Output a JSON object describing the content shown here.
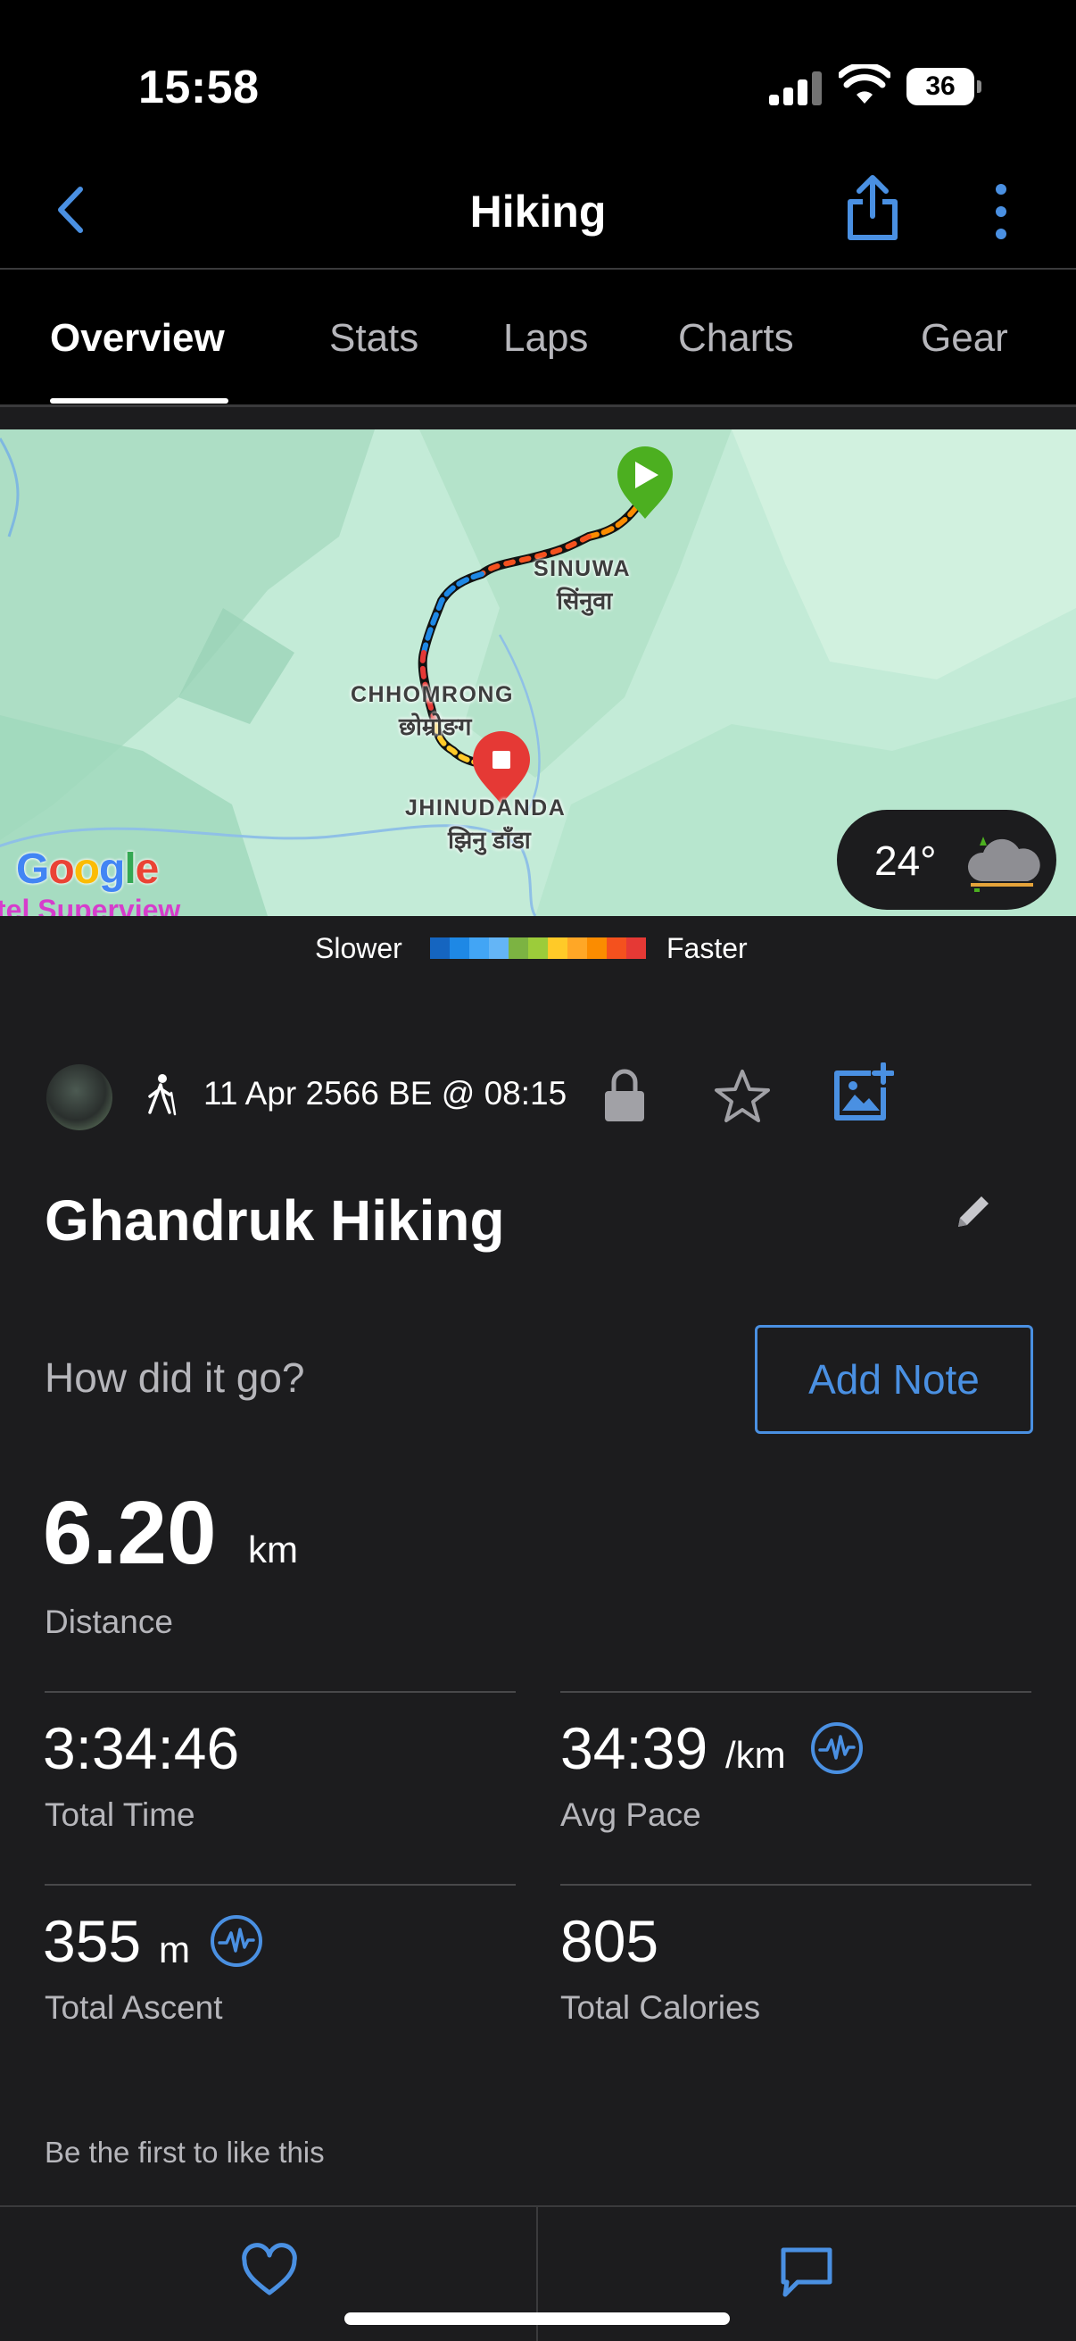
{
  "status_bar": {
    "time": "15:58",
    "battery": "36",
    "icons": [
      "signal-icon",
      "wifi-icon",
      "battery-icon"
    ]
  },
  "header": {
    "title": "Hiking",
    "icons": [
      "chevron-left-icon",
      "share-icon",
      "more-vertical-icon"
    ],
    "accent_color": "#4a90e2"
  },
  "tabs": [
    {
      "label": "Overview",
      "active": true
    },
    {
      "label": "Stats",
      "active": false
    },
    {
      "label": "Laps",
      "active": false
    },
    {
      "label": "Charts",
      "active": false
    },
    {
      "label": "Gear",
      "active": false
    }
  ],
  "map": {
    "labels": {
      "sinuwa": "SINUWA",
      "sinuwa_local": "सिंनुवा",
      "chhomrong": "CHHOMRONG",
      "chhomrong_local": "छोम्रोङग",
      "jhinudanda": "JHINUDANDA",
      "jhinudanda_local": "झिनु डाँडा"
    },
    "provider": "Google",
    "overflow_text": "tel Superview",
    "weather_temp": "24°",
    "start_color": "#4caf20",
    "end_color": "#e53935"
  },
  "legend": {
    "slower": "Slower",
    "faster": "Faster",
    "colors": [
      "#1565c0",
      "#1e88e5",
      "#42a5f5",
      "#64b5f6",
      "#7cb342",
      "#9ccc3a",
      "#ffca28",
      "#ffa726",
      "#fb8c00",
      "#f4511e",
      "#e53935"
    ]
  },
  "activity": {
    "date": "11 Apr 2566 BE @ 08:15",
    "title": "Ghandruk Hiking",
    "note_prompt": "How did it go?",
    "add_note_label": "Add Note"
  },
  "stats": {
    "distance": {
      "value": "6.20",
      "unit": "km",
      "label": "Distance"
    },
    "total_time": {
      "value": "3:34:46",
      "label": "Total Time"
    },
    "avg_pace": {
      "value": "34:39",
      "unit": "/km",
      "label": "Avg Pace"
    },
    "total_ascent": {
      "value": "355",
      "unit": "m",
      "label": "Total Ascent"
    },
    "total_calories": {
      "value": "805",
      "label": "Total Calories"
    }
  },
  "social": {
    "likes_text": "Be the first to like this"
  },
  "bottom_bar": {
    "icons": [
      "heart-icon",
      "comment-icon"
    ]
  }
}
